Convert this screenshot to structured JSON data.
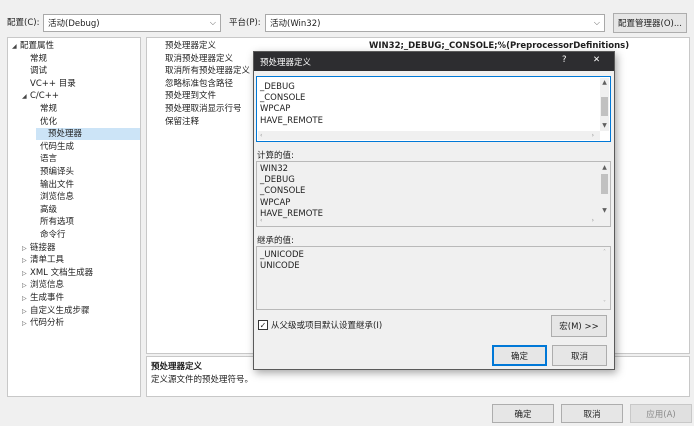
{
  "toolbar": {
    "config_label": "配置(C):",
    "config_value": "活动(Debug)",
    "platform_label": "平台(P):",
    "platform_value": "活动(Win32)",
    "config_manager_button": "配置管理器(O)..."
  },
  "tree": {
    "items": [
      {
        "label": "配置属性",
        "twisty": "◢",
        "level": 0
      },
      {
        "label": "常规",
        "twisty": "",
        "level": 1
      },
      {
        "label": "调试",
        "twisty": "",
        "level": 1
      },
      {
        "label": "VC++ 目录",
        "twisty": "",
        "level": 1
      },
      {
        "label": "C/C++",
        "twisty": "◢",
        "level": 1
      },
      {
        "label": "常规",
        "twisty": "",
        "level": 2
      },
      {
        "label": "优化",
        "twisty": "",
        "level": 2
      },
      {
        "label": "预处理器",
        "twisty": "",
        "level": 2,
        "selected": true
      },
      {
        "label": "代码生成",
        "twisty": "",
        "level": 2
      },
      {
        "label": "语言",
        "twisty": "",
        "level": 2
      },
      {
        "label": "预编译头",
        "twisty": "",
        "level": 2
      },
      {
        "label": "输出文件",
        "twisty": "",
        "level": 2
      },
      {
        "label": "浏览信息",
        "twisty": "",
        "level": 2
      },
      {
        "label": "高级",
        "twisty": "",
        "level": 2
      },
      {
        "label": "所有选项",
        "twisty": "",
        "level": 2
      },
      {
        "label": "命令行",
        "twisty": "",
        "level": 2
      },
      {
        "label": "链接器",
        "twisty": "▷",
        "level": 1
      },
      {
        "label": "清单工具",
        "twisty": "▷",
        "level": 1
      },
      {
        "label": "XML 文档生成器",
        "twisty": "▷",
        "level": 1
      },
      {
        "label": "浏览信息",
        "twisty": "▷",
        "level": 1
      },
      {
        "label": "生成事件",
        "twisty": "▷",
        "level": 1
      },
      {
        "label": "自定义生成步骤",
        "twisty": "▷",
        "level": 1
      },
      {
        "label": "代码分析",
        "twisty": "▷",
        "level": 1
      }
    ]
  },
  "properties": {
    "rows": [
      {
        "name": "预处理器定义",
        "value": "WIN32;_DEBUG;_CONSOLE;%(PreprocessorDefinitions)"
      },
      {
        "name": "取消预处理器定义",
        "value": ""
      },
      {
        "name": "取消所有预处理器定义",
        "value": ""
      },
      {
        "name": "忽略标准包含路径",
        "value": ""
      },
      {
        "name": "预处理到文件",
        "value": ""
      },
      {
        "name": "预处理取消显示行号",
        "value": ""
      },
      {
        "name": "保留注释",
        "value": ""
      }
    ]
  },
  "description": {
    "title": "预处理器定义",
    "text": "定义源文件的预处理符号。"
  },
  "bottom": {
    "ok": "确定",
    "cancel": "取消",
    "apply": "应用(A)"
  },
  "dialog": {
    "title": "预处理器定义",
    "help": "?",
    "close": "✕",
    "edit_lines": [
      "_DEBUG",
      "_CONSOLE",
      "WPCAP",
      "HAVE_REMOTE"
    ],
    "computed_label": "计算的值:",
    "computed_lines": [
      "WIN32",
      "_DEBUG",
      "_CONSOLE",
      "WPCAP",
      "HAVE_REMOTE"
    ],
    "inherited_label": "继承的值:",
    "inherited_lines": [
      "_UNICODE",
      "UNICODE"
    ],
    "inherit_checkbox": "从父级或项目默认设置继承(I)",
    "inherit_checked": true,
    "macros_button": "宏(M) >>",
    "ok": "确定",
    "cancel": "取消"
  }
}
